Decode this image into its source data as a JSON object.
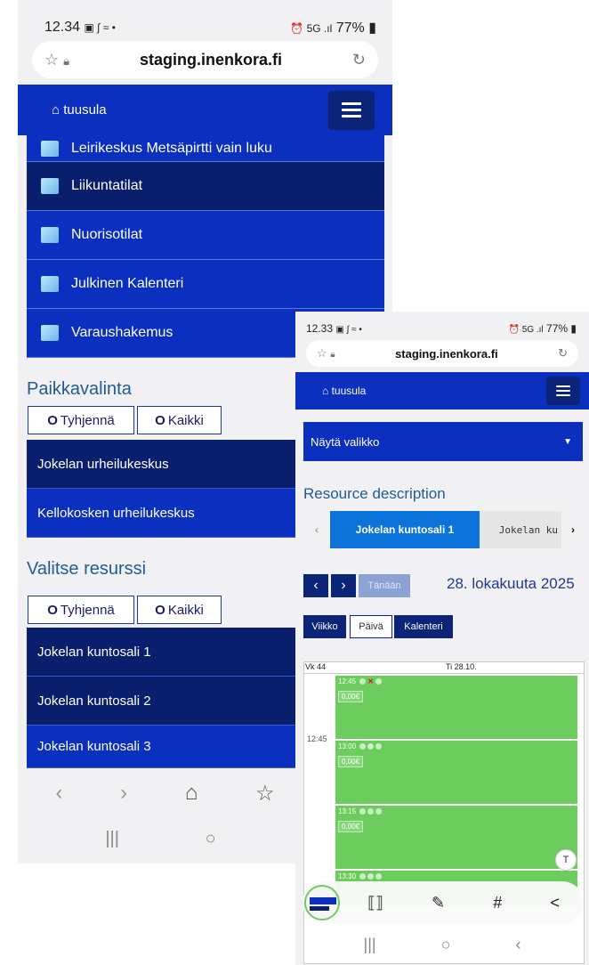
{
  "left_phone": {
    "status": {
      "time": "12.34",
      "battery": "77%"
    },
    "url": "staging.inenkora.fi",
    "nav": {
      "brand": "tuusula"
    },
    "menu_items": [
      {
        "label": "Leirikeskus Metsäpirtti vain luku"
      },
      {
        "label": "Liikuntatilat"
      },
      {
        "label": "Nuorisotilat"
      },
      {
        "label": "Julkinen Kalenteri"
      },
      {
        "label": "Varaushakemus"
      }
    ],
    "place_section": {
      "title": "Paikkavalinta",
      "clear_label": "Tyhjennä",
      "all_label": "Kaikki",
      "places": [
        "Jokelan urheilukeskus",
        "Kellokosken urheilukeskus"
      ]
    },
    "resource_section": {
      "title": "Valitse resurssi",
      "clear_label": "Tyhjennä",
      "all_label": "Kaikki",
      "resources": [
        "Jokelan kuntosali 1",
        "Jokelan kuntosali 2",
        "Jokelan kuntosali 3"
      ]
    },
    "bottom_nav": {
      "back": "‹",
      "forward": "›",
      "home": "⌂",
      "bookmarks": "☆",
      "recents": "|||",
      "home_btn": "○"
    }
  },
  "right_phone": {
    "status": {
      "time": "12.33",
      "battery": "77%"
    },
    "url": "staging.inenkora.fi",
    "nav": {
      "brand": "tuusula"
    },
    "show_menu_label": "Näytä valikko",
    "resource_description": "Resource description",
    "tabs": [
      "Jokelan kuntosali 1",
      "Jokelan ku"
    ],
    "today_label": "Tänään",
    "date_title": "28. lokakuuta 2025",
    "views": [
      "Viikko",
      "Päivä",
      "Kalenteri"
    ],
    "week_label": "Vk 44",
    "day_label": "Ti 28.10.",
    "time_label": "12:45",
    "events": [
      {
        "time": "12:45",
        "price": "0,00€"
      },
      {
        "time": "13:00",
        "price": "0,00€"
      },
      {
        "time": "13:15",
        "price": "0,00€"
      },
      {
        "time": "13:30",
        "price": ""
      }
    ],
    "toolbar": {
      "scan": "⟦⟧",
      "edit": "✎",
      "hash": "#",
      "share": "<"
    },
    "bottom_nav": {
      "recents": "|||",
      "home_btn": "○",
      "back": "‹"
    }
  },
  "colors": {
    "nav_blue": "#0b2fbf",
    "dark_navy": "#0a1e6e",
    "event_green": "#6ccc5d",
    "title_blue": "#1f5b94"
  }
}
